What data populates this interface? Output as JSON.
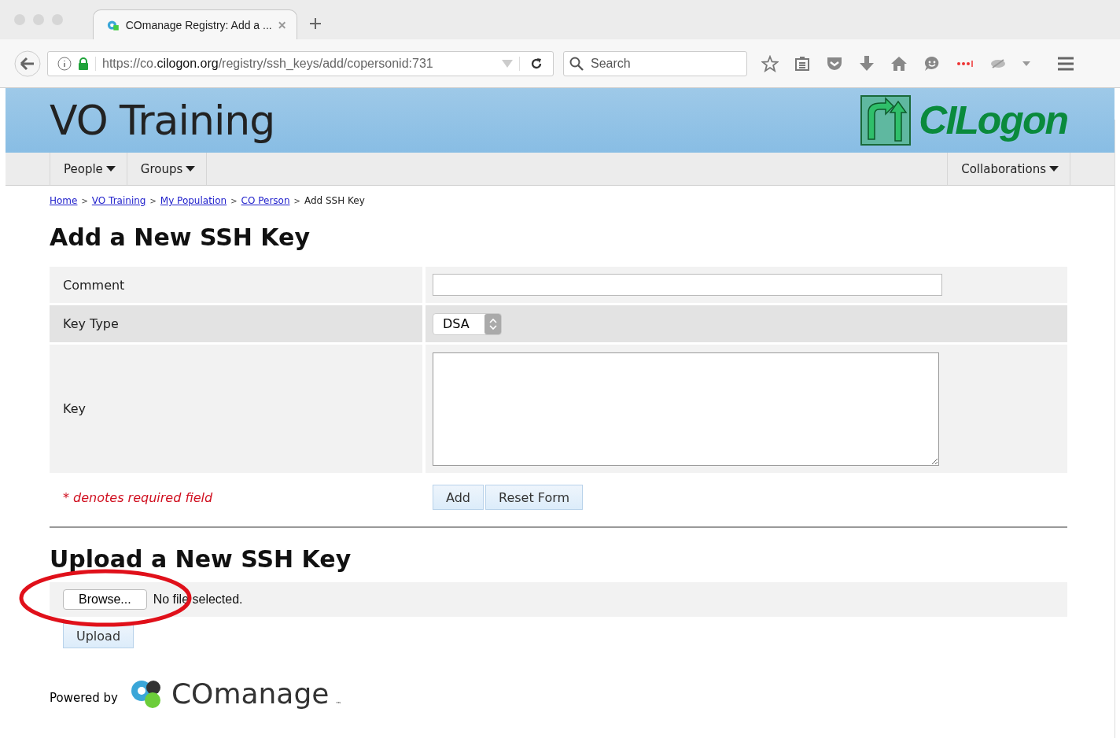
{
  "browser": {
    "tab_title": "COmanage Registry: Add a ...",
    "url_prefix": "https://co.",
    "url_domain": "cilogon.org",
    "url_path": "/registry/ssh_keys/add/copersonid:731",
    "search": {
      "placeholder": "Search"
    }
  },
  "header": {
    "title": "VO Training",
    "logo_text": "CILogon"
  },
  "nav": {
    "left": [
      {
        "label": "People"
      },
      {
        "label": "Groups"
      }
    ],
    "right": [
      {
        "label": "Collaborations"
      }
    ]
  },
  "breadcrumbs": [
    {
      "label": "Home",
      "link": true
    },
    {
      "separator": ">",
      "label": "VO Training",
      "link": true
    },
    {
      "separator": ">",
      "label": "My Population",
      "link": true
    },
    {
      "separator": ">",
      "label": "CO Person",
      "link": true
    },
    {
      "separator": ">",
      "label": "Add SSH Key",
      "link": false
    }
  ],
  "add_section": {
    "heading": "Add a New SSH Key",
    "rows": [
      {
        "kind": "text",
        "label": "Comment"
      },
      {
        "kind": "select",
        "label": "Key Type",
        "value": "DSA"
      },
      {
        "kind": "textarea",
        "label": "Key"
      }
    ],
    "required_note": "* denotes required field",
    "buttons": [
      "Add",
      "Reset Form"
    ]
  },
  "upload_section": {
    "heading": "Upload a New SSH Key",
    "browse": "Browse...",
    "file_status": "No file selected.",
    "upload": "Upload",
    "highlighted": true
  },
  "footer": {
    "powered_by": "Powered by",
    "logo_text": "COmanage",
    "trademark": "™"
  }
}
